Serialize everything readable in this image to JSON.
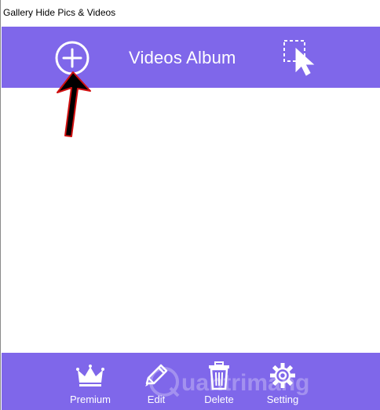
{
  "window": {
    "title": "Gallery Hide Pics & Videos"
  },
  "header": {
    "title": "Videos Album",
    "add_icon": "plus-circle-icon",
    "select_icon": "selection-cursor-icon"
  },
  "annotation": {
    "arrow": "pointer-arrow"
  },
  "bottom_nav": {
    "items": [
      {
        "label": "Premium",
        "icon": "crown-icon"
      },
      {
        "label": "Edit",
        "icon": "pencil-icon"
      },
      {
        "label": "Delete",
        "icon": "trash-icon"
      },
      {
        "label": "Setting",
        "icon": "gear-icon"
      }
    ]
  },
  "watermark": {
    "text": "uantrimang"
  },
  "colors": {
    "accent": "#7f67ea",
    "background": "#ffffff",
    "arrow_fill": "#000000",
    "arrow_outline": "#d01010"
  }
}
